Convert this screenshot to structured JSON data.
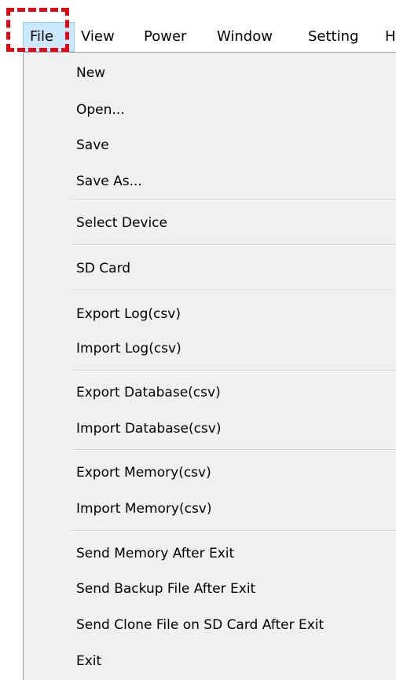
{
  "menubar": {
    "items": [
      {
        "label": "File"
      },
      {
        "label": "View"
      },
      {
        "label": "Power"
      },
      {
        "label": "Window"
      },
      {
        "label": "Setting"
      },
      {
        "label": "H"
      }
    ]
  },
  "file_menu": {
    "items": [
      {
        "label": "New"
      },
      {
        "label": "Open..."
      },
      {
        "label": "Save"
      },
      {
        "label": "Save As..."
      },
      {
        "label": "Select Device"
      },
      {
        "label": "SD Card"
      },
      {
        "label": "Export Log(csv)"
      },
      {
        "label": "Import Log(csv)"
      },
      {
        "label": "Export Database(csv)"
      },
      {
        "label": "Import Database(csv)"
      },
      {
        "label": "Export Memory(csv)"
      },
      {
        "label": "Import Memory(csv)"
      },
      {
        "label": "Send Memory After Exit"
      },
      {
        "label": "Send Backup File After Exit"
      },
      {
        "label": "Send Clone File on SD Card After Exit"
      },
      {
        "label": "Exit"
      }
    ]
  },
  "colors": {
    "highlight_outline": "#e30613",
    "selected_menu_bg": "#cce8ff",
    "menu_bg": "#f0f0f0"
  }
}
